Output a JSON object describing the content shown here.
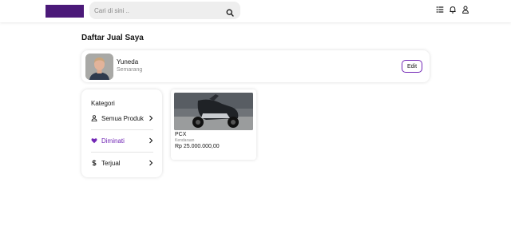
{
  "header": {
    "search": {
      "placeholder": "Cari di sini ..",
      "value": ""
    },
    "icons": [
      "list-icon",
      "bell-icon",
      "user-icon"
    ]
  },
  "page": {
    "title": "Daftar Jual Saya"
  },
  "seller": {
    "name": "Yuneda",
    "city": "Semarang",
    "edit_label": "Edit"
  },
  "categories": {
    "title": "Kategori",
    "items": [
      {
        "label": "Semua Produk",
        "icon": "box-icon",
        "active": false
      },
      {
        "label": "Diminati",
        "icon": "heart-icon",
        "active": true
      },
      {
        "label": "Terjual",
        "icon": "dollar-icon",
        "active": false
      }
    ]
  },
  "products": [
    {
      "name": "PCX",
      "category": "Kendaraan",
      "price": "Rp 25.000.000,00"
    }
  ],
  "colors": {
    "brand": "#4b1979",
    "accent": "#7126b5"
  }
}
